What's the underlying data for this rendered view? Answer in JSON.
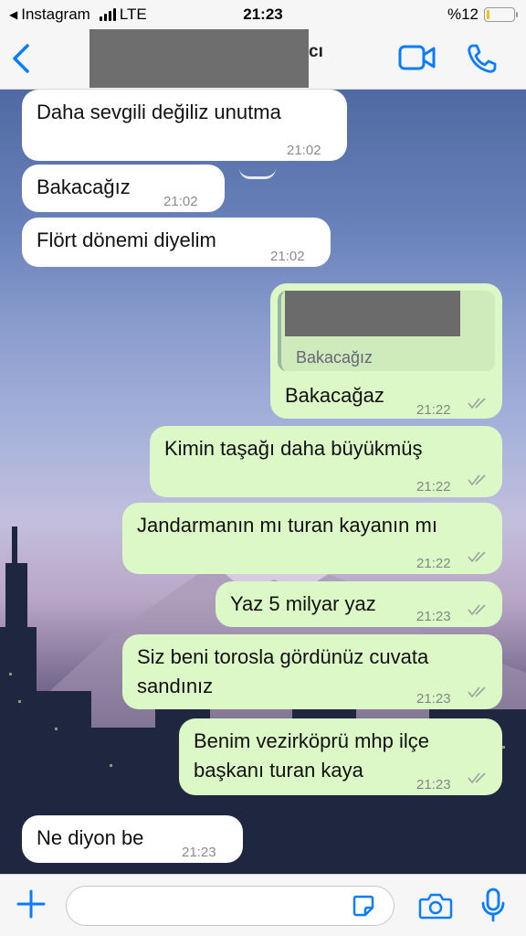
{
  "status_bar": {
    "back_app": "Instagram",
    "network": "LTE",
    "time": "21:23",
    "battery": "%12",
    "battery_level": 0.12
  },
  "header": {
    "contact_name_visible": "cı"
  },
  "messages": [
    {
      "dir": "in",
      "text": "Daha sevgili değiliz unutma",
      "time": "21:02"
    },
    {
      "dir": "in",
      "text": "Bakacağız",
      "time": "21:02"
    },
    {
      "dir": "in",
      "text": "Flört dönemi diyelim",
      "time": "21:02"
    },
    {
      "dir": "out",
      "quote": "Bakacağız",
      "text": "Bakacağaz",
      "time": "21:22"
    },
    {
      "dir": "out",
      "text": "Kimin taşağı daha büyükmüş",
      "time": "21:22"
    },
    {
      "dir": "out",
      "text": "Jandarmanın mı turan kayanın mı",
      "time": "21:22"
    },
    {
      "dir": "out",
      "text": "Yaz 5 milyar yaz",
      "time": "21:23"
    },
    {
      "dir": "out",
      "text": "Siz beni torosla gördünüz cuvata",
      "text2": "sandınız",
      "time": "21:23"
    },
    {
      "dir": "out",
      "text": "Benim vezirköprü mhp ilçe",
      "text2": "başkanı turan kaya",
      "time": "21:23"
    },
    {
      "dir": "in",
      "text": "Ne diyon be",
      "time": "21:23"
    }
  ],
  "input": {
    "placeholder": ""
  },
  "colors": {
    "accent": "#0a7cff",
    "outgoing_bubble": "#dcf8c6",
    "incoming_bubble": "#ffffff",
    "battery": "#f0c400"
  },
  "icons": [
    "back-chevron-icon",
    "video-call-icon",
    "phone-call-icon",
    "plus-icon",
    "sticker-icon",
    "camera-icon",
    "microphone-icon"
  ]
}
